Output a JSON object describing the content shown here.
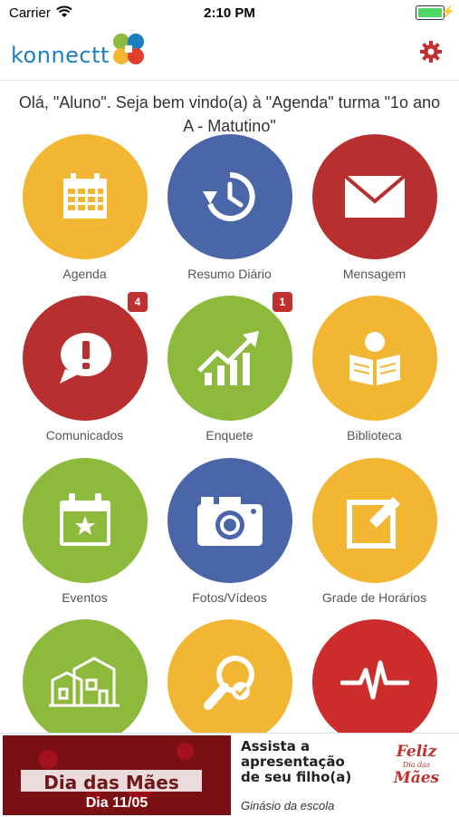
{
  "status_bar": {
    "carrier": "Carrier",
    "time": "2:10 PM"
  },
  "header": {
    "logo_text": "konnectt",
    "settings_icon": "gear-icon"
  },
  "welcome": "Olá, \"Aluno\". Seja bem vindo(a) à \"Agenda\" turma \"1o ano A - Matutino\"",
  "tiles": [
    {
      "label": "Agenda",
      "color": "#F2B632",
      "icon": "calendar-icon"
    },
    {
      "label": "Resumo Diário",
      "color": "#4A65A8",
      "icon": "history-icon"
    },
    {
      "label": "Mensagem",
      "color": "#B7302F",
      "icon": "envelope-icon"
    },
    {
      "label": "Comunicados",
      "color": "#B7302F",
      "icon": "alert-bubble-icon",
      "badge": "4"
    },
    {
      "label": "Enquete",
      "color": "#8DBA3D",
      "icon": "trending-chart-icon",
      "badge": "1"
    },
    {
      "label": "Biblioteca",
      "color": "#F2B632",
      "icon": "reader-book-icon"
    },
    {
      "label": "Eventos",
      "color": "#8DBA3D",
      "icon": "calendar-star-icon"
    },
    {
      "label": "Fotos/Vídeos",
      "color": "#4A65A8",
      "icon": "camera-icon"
    },
    {
      "label": "Grade de Horários",
      "color": "#F2B632",
      "icon": "edit-icon"
    },
    {
      "label": "",
      "color": "#8DBA3D",
      "icon": "school-building-icon"
    },
    {
      "label": "",
      "color": "#F2B632",
      "icon": "search-check-icon"
    },
    {
      "label": "",
      "color": "#CC2C2C",
      "icon": "heartbeat-icon"
    }
  ],
  "banner": {
    "left_title": "Dia das Mães",
    "left_date": "Dia 11/05",
    "right_line1": "Assista a",
    "right_line2": "apresentação",
    "right_line3": "de seu filho(a)",
    "right_sub": "Ginásio da escola",
    "feliz_a": "Feliz",
    "feliz_b": "Dia das",
    "feliz_c": "Mães"
  }
}
